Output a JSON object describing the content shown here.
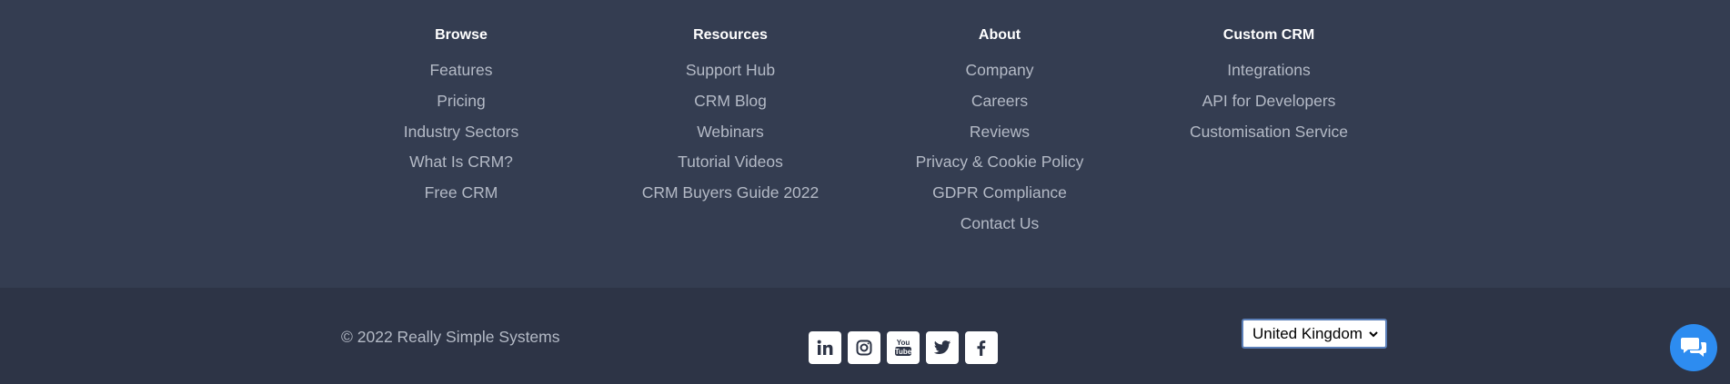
{
  "columns": [
    {
      "heading": "Browse",
      "items": [
        "Features",
        "Pricing",
        "Industry Sectors",
        "What Is CRM?",
        "Free CRM"
      ]
    },
    {
      "heading": "Resources",
      "items": [
        "Support Hub",
        "CRM Blog",
        "Webinars",
        "Tutorial Videos",
        "CRM Buyers Guide 2022"
      ]
    },
    {
      "heading": "About",
      "items": [
        "Company",
        "Careers",
        "Reviews",
        "Privacy & Cookie Policy",
        "GDPR Compliance",
        "Contact Us"
      ]
    },
    {
      "heading": "Custom CRM",
      "items": [
        "Integrations",
        "API for Developers",
        "Customisation Service"
      ]
    }
  ],
  "copyright": "© 2022 Really Simple Systems",
  "socials": [
    "linkedin-icon",
    "instagram-icon",
    "youtube-icon",
    "twitter-icon",
    "facebook-icon"
  ],
  "country_select": {
    "value": "United Kingdom"
  },
  "chat": {
    "icon": "chat-bubbles-icon"
  },
  "colors": {
    "background_top": "#343d51",
    "background_bottom": "#2d3446",
    "link_text": "#b4bac6",
    "heading_text": "#ffffff",
    "chat_accent": "#2d8cf0"
  }
}
